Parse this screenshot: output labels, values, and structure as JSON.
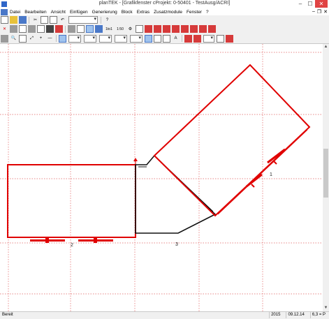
{
  "window": {
    "title": "planTEK - [Grafikfenster cProjekt: 0-50401 - TestAusg/ACRI]"
  },
  "menubar": {
    "items": [
      "Datei",
      "Bearbeiten",
      "Ansicht",
      "Einfügen",
      "Generierung",
      "Block",
      "Extras",
      "Zusatzmodule",
      "Fenster",
      "?"
    ]
  },
  "toolbar": {
    "zoom_label_1": "1to1",
    "zoom_label_2": "1:50"
  },
  "drawing": {
    "labels": [
      "1",
      "2",
      "3"
    ],
    "colors": {
      "wall": "#e00000",
      "outline": "#111111",
      "grid": "#e06060"
    }
  },
  "status": {
    "left": "Bereit",
    "year": "2015",
    "date": "09.12.14",
    "zoom": "6,3 = P"
  }
}
